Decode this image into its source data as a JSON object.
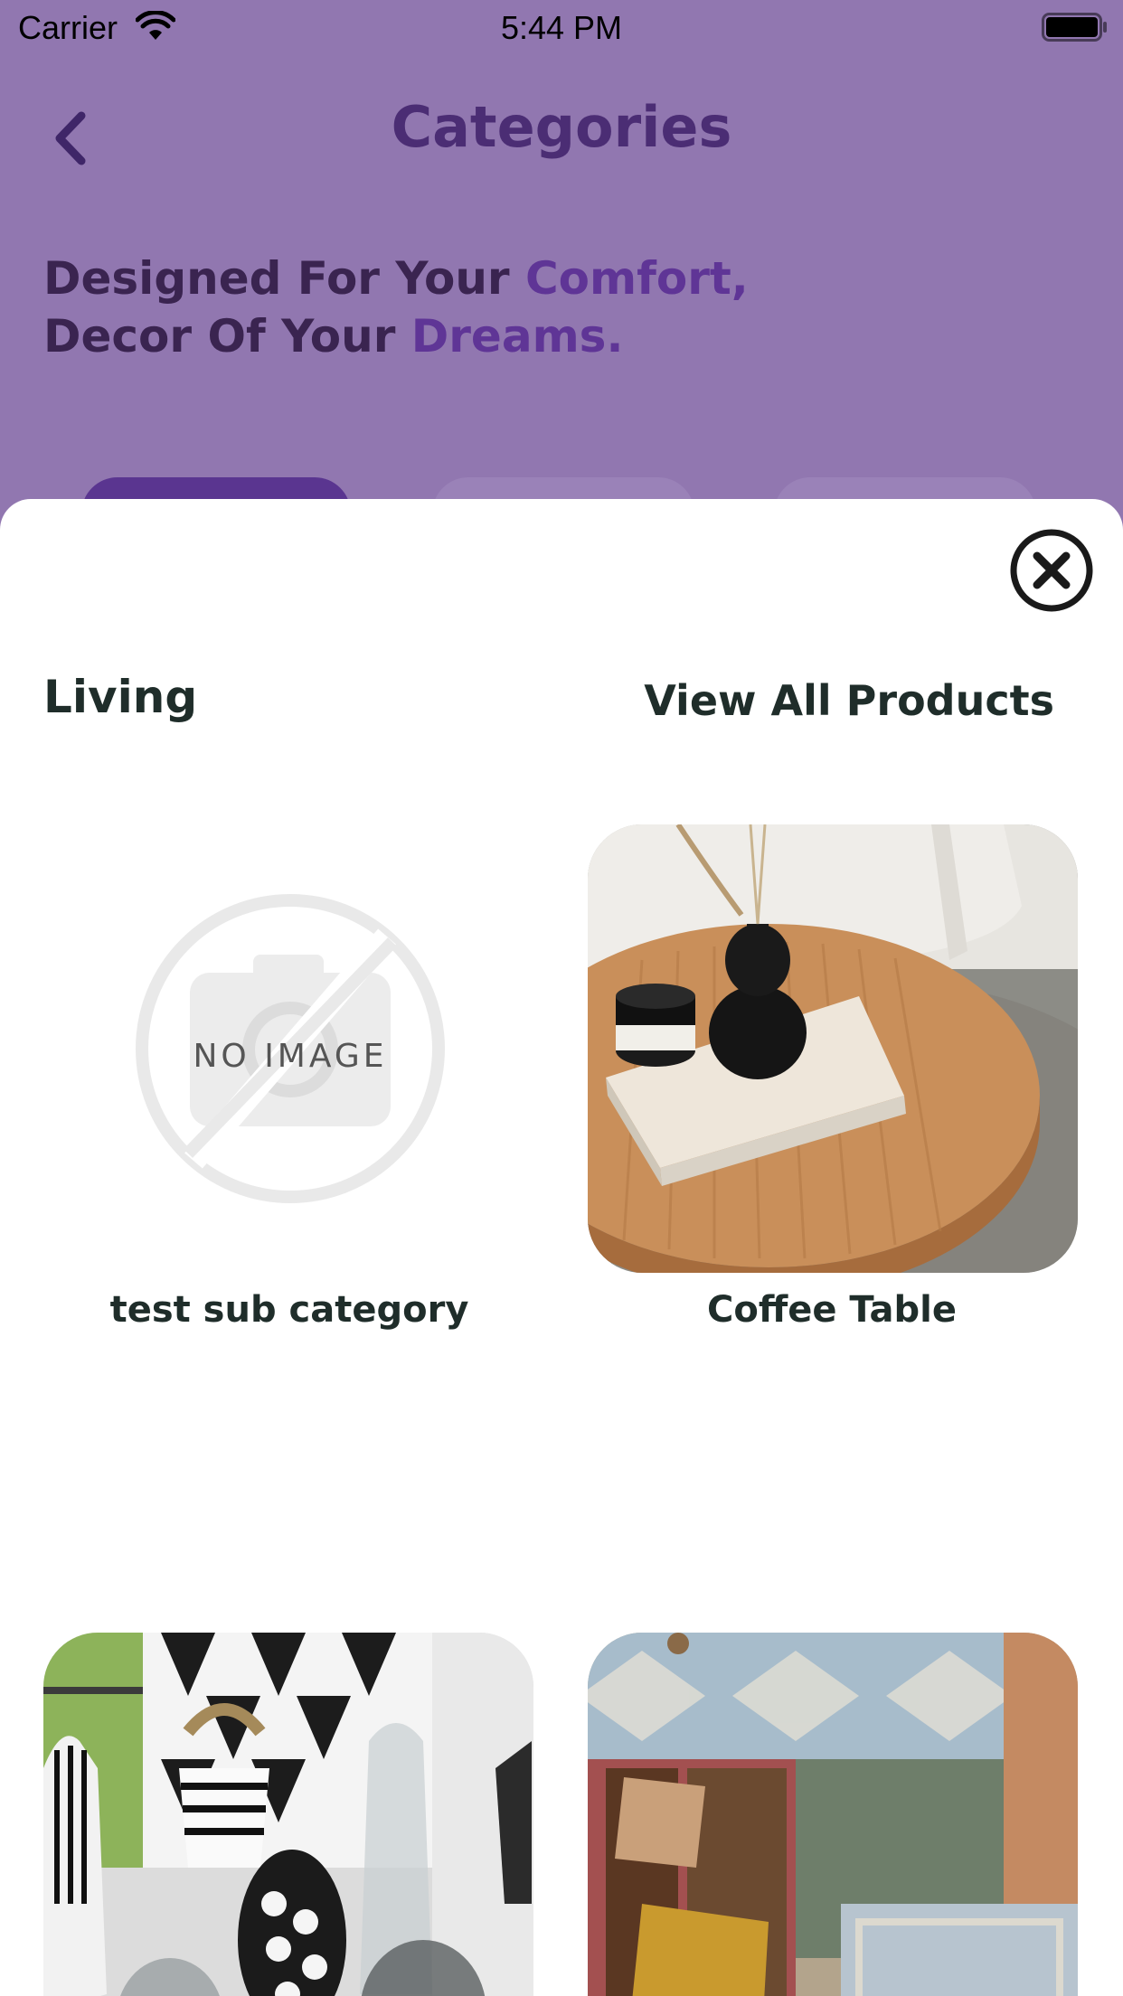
{
  "status_bar": {
    "carrier": "Carrier",
    "time": "5:44 PM",
    "icons": [
      "wifi-icon",
      "battery-icon"
    ]
  },
  "header": {
    "title": "Categories",
    "back_icon": "chevron-left-icon"
  },
  "tagline": {
    "line1_prefix": "Designed For Your ",
    "line1_accent": "Comfort,",
    "line2_prefix": "Decor Of Your ",
    "line2_accent": "Dreams."
  },
  "sheet": {
    "close_icon": "close-circle-icon",
    "section_title": "Living",
    "view_all_label": "View All Products",
    "items": [
      {
        "label": "test sub category",
        "image": "no-image-placeholder",
        "placeholder_text": "NO IMAGE"
      },
      {
        "label": "Coffee Table",
        "image": "coffee-table-photo"
      },
      {
        "label": "",
        "image": "vases-photo"
      },
      {
        "label": "",
        "image": "rugs-photo"
      }
    ]
  },
  "colors": {
    "background": "#9177b0",
    "title": "#4b2d74",
    "accent": "#5f3596",
    "chip_active": "#5a3590",
    "text_dark": "#1f2d2a"
  }
}
